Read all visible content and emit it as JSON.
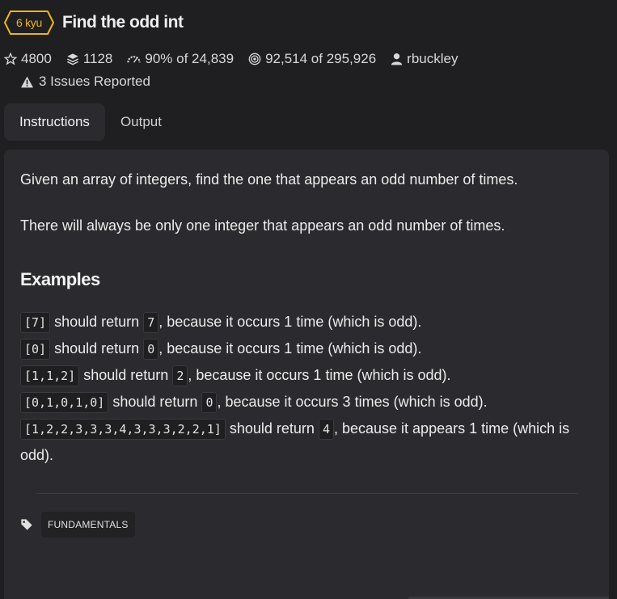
{
  "kata": {
    "rank": "6 kyu",
    "title": "Find the odd int"
  },
  "stats": {
    "stars": "4800",
    "collections": "1128",
    "satisfaction_pct": "90%",
    "satisfaction_of": "of 24,839",
    "completed": "92,514",
    "completed_of": "of 295,926",
    "author": "rbuckley"
  },
  "issues": {
    "label": "3 Issues Reported"
  },
  "tabs": [
    {
      "label": "Instructions",
      "active": true
    },
    {
      "label": "Output",
      "active": false
    }
  ],
  "description": [
    "Given an array of integers, find the one that appears an odd number of times.",
    "There will always be only one integer that appears an odd number of times."
  ],
  "examples_heading": "Examples",
  "examples": [
    {
      "input": "[7]",
      "mid": "should return",
      "output": "7",
      "tail": ", because it occurs 1 time (which is odd)."
    },
    {
      "input": "[0]",
      "mid": "should return",
      "output": "0",
      "tail": ", because it occurs 1 time (which is odd)."
    },
    {
      "input": "[1,1,2]",
      "mid": "should return",
      "output": "2",
      "tail": ", because it occurs 1 time (which is odd)."
    },
    {
      "input": "[0,1,0,1,0]",
      "mid": "should return",
      "output": "0",
      "tail": ", because it occurs 3 times (which is odd)."
    },
    {
      "input": "[1,2,2,3,3,3,4,3,3,3,2,2,1]",
      "mid": "should return",
      "output": "4",
      "tail": ", because it appears 1 time (which is odd)."
    }
  ],
  "tags": [
    "FUNDAMENTALS"
  ],
  "colors": {
    "background": "#1f1f22",
    "panel": "#2b2b2f",
    "rank_accent": "#ecb613"
  },
  "icons": {
    "rank_badge": "hexagon-badge",
    "stars": "star-outline-icon",
    "collections": "layers-icon",
    "satisfaction": "gauge-icon",
    "completed": "target-icon",
    "author": "user-icon",
    "issues": "warning-icon",
    "tag": "tag-icon"
  }
}
